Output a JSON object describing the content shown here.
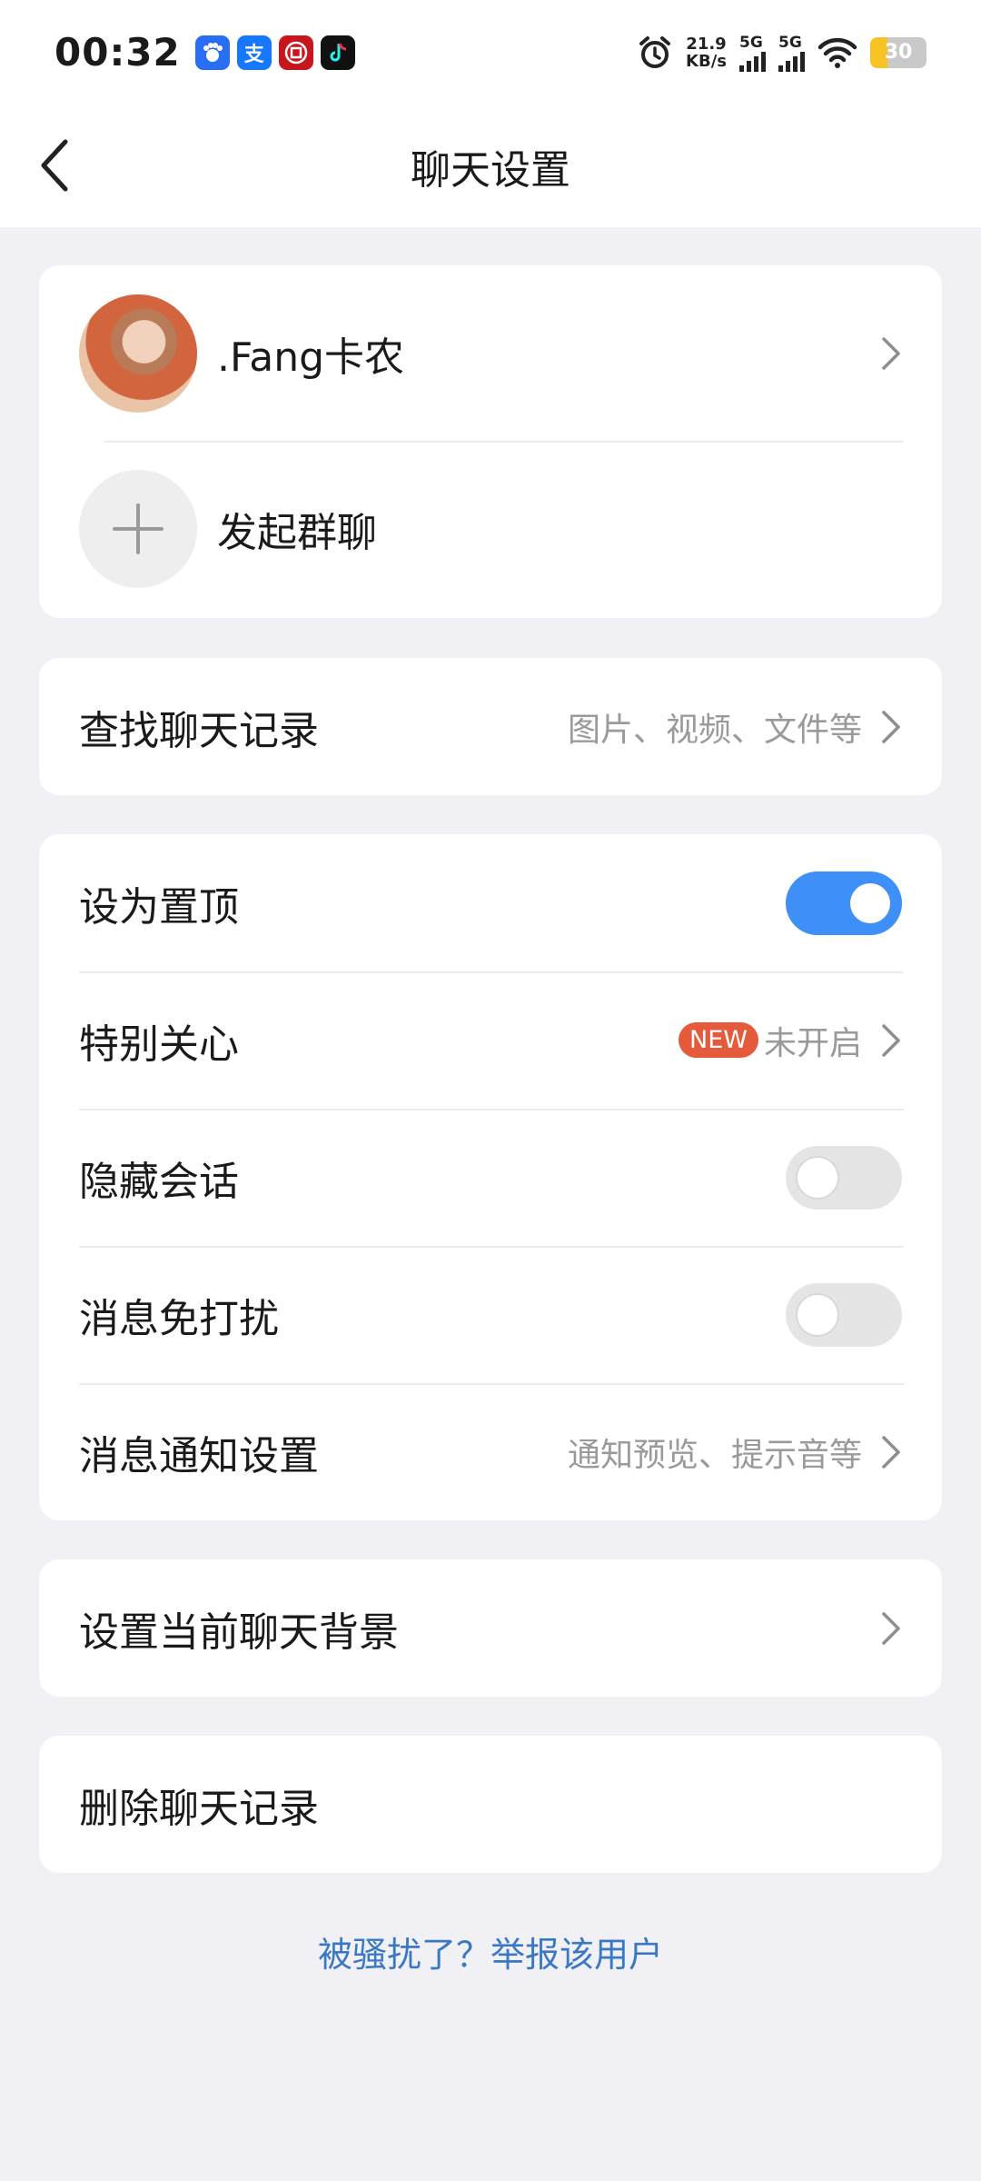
{
  "status_bar": {
    "time": "00:32",
    "apps": [
      {
        "icon": "baidu-icon",
        "glyph": "🐾",
        "color": "#2a6df5"
      },
      {
        "icon": "alipay-icon",
        "glyph": "支",
        "color": "#1677ff"
      },
      {
        "icon": "bank-icon",
        "glyph": "回",
        "color": "#c8161d"
      },
      {
        "icon": "tiktok-icon",
        "glyph": "♪",
        "color": "#111111"
      }
    ],
    "speed_value": "21.9",
    "speed_unit": "KB/s",
    "signal_1": "5G",
    "signal_2": "5G",
    "battery": "30",
    "battery_level": 0.3
  },
  "nav": {
    "title": "聊天设置"
  },
  "profile": {
    "name": ".Fang卡农",
    "group_label": "发起群聊"
  },
  "search_card": {
    "label": "查找聊天记录",
    "hint": "图片、视频、文件等"
  },
  "settings": {
    "pin": {
      "label": "设为置顶",
      "enabled": true
    },
    "special_care": {
      "label": "特别关心",
      "badge": "NEW",
      "value": "未开启"
    },
    "hide_chat": {
      "label": "隐藏会话",
      "enabled": false
    },
    "mute": {
      "label": "消息免打扰",
      "enabled": false
    },
    "notify": {
      "label": "消息通知设置",
      "hint": "通知预览、提示音等"
    }
  },
  "background": {
    "label": "设置当前聊天背景"
  },
  "delete": {
    "label": "删除聊天记录"
  },
  "report": {
    "label": "被骚扰了？举报该用户"
  },
  "colors": {
    "accent": "#3e8ff7",
    "link": "#3b78c4",
    "badge": "#e65a3c",
    "background": "#f0f0f5"
  }
}
